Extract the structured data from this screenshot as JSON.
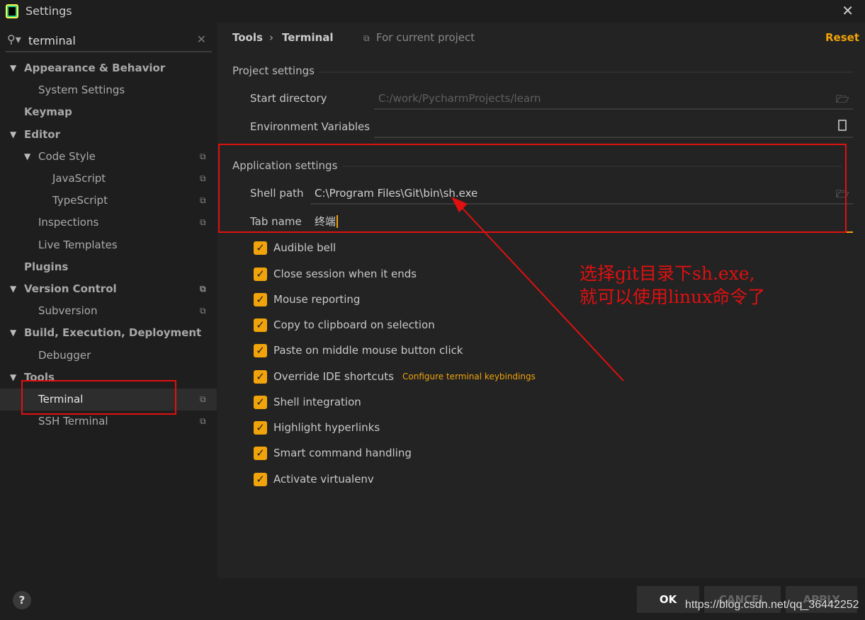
{
  "window": {
    "title": "Settings",
    "close": "✕"
  },
  "search": {
    "value": "terminal",
    "icon": "search-icon",
    "clear": "✕"
  },
  "tree": [
    {
      "label": "Appearance & Behavior",
      "level": 0,
      "bold": true,
      "expanded": true,
      "copy": false
    },
    {
      "label": "System Settings",
      "level": 1,
      "bold": false,
      "copy": false
    },
    {
      "label": "Keymap",
      "level": 0,
      "bold": true,
      "copy": false
    },
    {
      "label": "Editor",
      "level": 0,
      "bold": true,
      "expanded": true,
      "copy": false
    },
    {
      "label": "Code Style",
      "level": 1,
      "bold": false,
      "expanded": true,
      "copy": true
    },
    {
      "label": "JavaScript",
      "level": 2,
      "bold": false,
      "copy": true
    },
    {
      "label": "TypeScript",
      "level": 2,
      "bold": false,
      "copy": true
    },
    {
      "label": "Inspections",
      "level": 1,
      "bold": false,
      "copy": true
    },
    {
      "label": "Live Templates",
      "level": 1,
      "bold": false,
      "copy": false
    },
    {
      "label": "Plugins",
      "level": 0,
      "bold": true,
      "copy": false
    },
    {
      "label": "Version Control",
      "level": 0,
      "bold": true,
      "expanded": true,
      "copy": true
    },
    {
      "label": "Subversion",
      "level": 1,
      "bold": false,
      "copy": true
    },
    {
      "label": "Build, Execution, Deployment",
      "level": 0,
      "bold": true,
      "expanded": true,
      "copy": false
    },
    {
      "label": "Debugger",
      "level": 1,
      "bold": false,
      "copy": false
    },
    {
      "label": "Tools",
      "level": 0,
      "bold": true,
      "expanded": true,
      "copy": false
    },
    {
      "label": "Terminal",
      "level": 1,
      "bold": false,
      "selected": true,
      "copy": true
    },
    {
      "label": "SSH Terminal",
      "level": 1,
      "bold": false,
      "copy": true
    }
  ],
  "header": {
    "crumb1": "Tools",
    "sep": "›",
    "crumb2": "Terminal",
    "scope": "For current project",
    "reset": "Reset"
  },
  "project": {
    "title": "Project settings",
    "start_dir_label": "Start directory",
    "start_dir_placeholder": "C:/work/PycharmProjects/learn",
    "env_label": "Environment Variables"
  },
  "app": {
    "title": "Application settings",
    "shell_label": "Shell path",
    "shell_value": "C:\\Program Files\\Git\\bin\\sh.exe",
    "tab_label": "Tab name",
    "tab_value": "终端"
  },
  "checkboxes": [
    {
      "label": "Audible bell",
      "checked": true
    },
    {
      "label": "Close session when it ends",
      "checked": true
    },
    {
      "label": "Mouse reporting",
      "checked": true
    },
    {
      "label": "Copy to clipboard on selection",
      "checked": true
    },
    {
      "label": "Paste on middle mouse button click",
      "checked": true
    },
    {
      "label": "Override IDE shortcuts",
      "checked": true
    },
    {
      "label": "Shell integration",
      "checked": true
    },
    {
      "label": "Highlight hyperlinks",
      "checked": true
    },
    {
      "label": "Smart command handling",
      "checked": true
    },
    {
      "label": "Activate virtualenv",
      "checked": true
    }
  ],
  "keybindings_link": "Configure terminal keybindings",
  "annotation": {
    "line1": "选择git目录下sh.exe,",
    "line2": "就可以使用linux命令了",
    "color": "#e01010"
  },
  "footer": {
    "help": "?",
    "ok": "OK",
    "cancel": "CANCEL",
    "apply": "APPLY",
    "watermark": "https://blog.csdn.net/qq_36442252"
  },
  "colors": {
    "accent": "#f0a30a",
    "annotation": "#e01010"
  }
}
